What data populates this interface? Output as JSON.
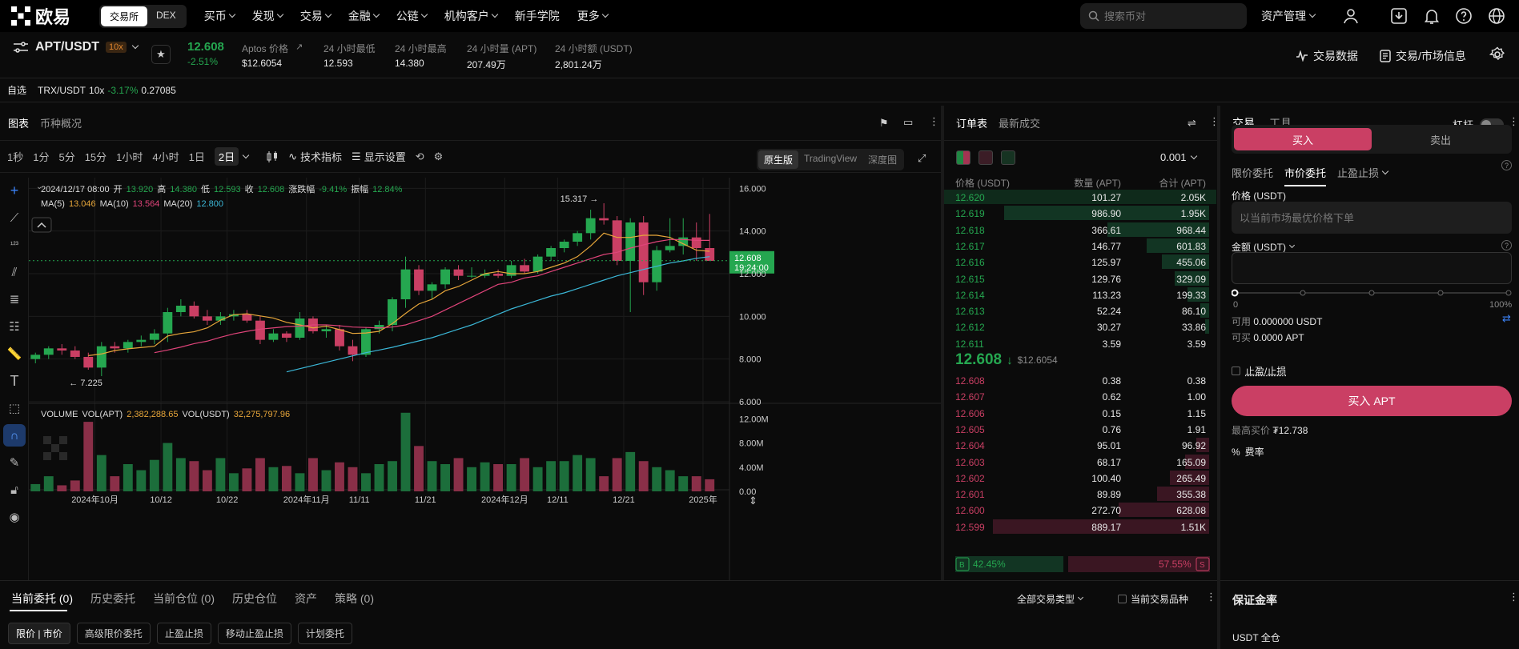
{
  "nav": {
    "brand": "欧易",
    "mode_tabs": [
      "交易所",
      "DEX"
    ],
    "items": [
      "买币",
      "发现",
      "交易",
      "金融",
      "公链",
      "机构客户",
      "新手学院",
      "更多"
    ],
    "items_with_chevron": [
      true,
      true,
      true,
      true,
      true,
      true,
      false,
      true
    ],
    "search_placeholder": "搜索币对",
    "asset_mgmt": "资产管理"
  },
  "ticker": {
    "pair": "APT/USDT",
    "leverage": "10x",
    "last_price": "12.608",
    "change_pct": "-2.51%",
    "stats": [
      {
        "label": "Aptos 价格",
        "value": "$12.6054"
      },
      {
        "label": "24 小时最低",
        "value": "12.593"
      },
      {
        "label": "24 小时最高",
        "value": "14.380"
      },
      {
        "label": "24 小时量 (APT)",
        "value": "207.49万"
      },
      {
        "label": "24 小时额 (USDT)",
        "value": "2,801.24万"
      }
    ],
    "right_links": [
      "交易数据",
      "交易/市场信息"
    ]
  },
  "favbar": {
    "label": "自选",
    "pair": "TRX/USDT",
    "lev": "10x",
    "chg": "-3.17%",
    "price": "0.27085"
  },
  "chart_panel": {
    "tabs": [
      "图表",
      "币种概况"
    ],
    "timeframes": [
      "1秒",
      "1分",
      "5分",
      "15分",
      "1小时",
      "4小时",
      "1日",
      "2日"
    ],
    "active_timeframe": "2日",
    "indicators_label": "技术指标",
    "display_label": "显示设置",
    "views": [
      "原生版",
      "TradingView",
      "深度图"
    ],
    "active_view": "原生版",
    "ohlc": {
      "date": "2024/12/17 08:00",
      "open_label": "开",
      "open": "13.920",
      "high_label": "高",
      "high": "14.380",
      "low_label": "低",
      "low": "12.593",
      "close_label": "收",
      "close": "12.608",
      "chg_label": "涨跌幅",
      "chg": "-9.41%",
      "amp_label": "振幅",
      "amp": "12.84%"
    },
    "ma": {
      "ma5_label": "MA(5)",
      "ma5": "13.046",
      "ma10_label": "MA(10)",
      "ma10": "13.564",
      "ma20_label": "MA(20)",
      "ma20": "12.800"
    },
    "volume": {
      "label": "VOLUME",
      "apt_label": "VOL(APT)",
      "apt": "2,382,288.65",
      "usdt_label": "VOL(USDT)",
      "usdt": "32,275,797.96"
    },
    "current_price_tag": "12.608",
    "countdown": "19:24:00",
    "max_label": "15.317 →",
    "min_label": "← 7.225"
  },
  "chart_data": {
    "type": "candlestick",
    "ylim": [
      6,
      16.5
    ],
    "y_ticks": [
      "16.000",
      "14.000",
      "12.000",
      "10.000",
      "8.000",
      "6.000"
    ],
    "y_tick_values": [
      16,
      14,
      12,
      10,
      8,
      6
    ],
    "x_ticks": [
      "2024年10月",
      "10/12",
      "10/22",
      "2024年11月",
      "11/11",
      "11/21",
      "2024年12月",
      "12/11",
      "12/21",
      "2025年"
    ],
    "x_tick_index": [
      4.5,
      9.5,
      14.5,
      20.5,
      24.5,
      29.5,
      35.5,
      39.5,
      44.5,
      50.5
    ],
    "vol_ticks": [
      "12.00M",
      "8.00M",
      "4.00M",
      "0.00"
    ],
    "vol_tick_values": [
      12,
      8,
      4,
      0
    ],
    "vol_max": 13.5,
    "n_slots": 53,
    "candles": [
      {
        "o": 8.0,
        "h": 8.3,
        "l": 7.8,
        "c": 8.2
      },
      {
        "o": 8.2,
        "h": 8.6,
        "l": 8.0,
        "c": 8.5
      },
      {
        "o": 8.5,
        "h": 8.7,
        "l": 8.2,
        "c": 8.4
      },
      {
        "o": 8.4,
        "h": 8.6,
        "l": 8.0,
        "c": 8.1
      },
      {
        "o": 8.1,
        "h": 8.3,
        "l": 7.5,
        "c": 7.6
      },
      {
        "o": 7.6,
        "h": 8.8,
        "l": 7.2,
        "c": 8.6
      },
      {
        "o": 8.6,
        "h": 8.8,
        "l": 8.3,
        "c": 8.5
      },
      {
        "o": 8.5,
        "h": 8.9,
        "l": 8.3,
        "c": 8.8
      },
      {
        "o": 8.8,
        "h": 9.1,
        "l": 8.6,
        "c": 8.9
      },
      {
        "o": 8.9,
        "h": 9.4,
        "l": 8.7,
        "c": 9.2
      },
      {
        "o": 9.2,
        "h": 10.4,
        "l": 8.8,
        "c": 10.2
      },
      {
        "o": 10.2,
        "h": 10.8,
        "l": 10.0,
        "c": 10.5
      },
      {
        "o": 10.5,
        "h": 10.7,
        "l": 9.9,
        "c": 10.0
      },
      {
        "o": 10.0,
        "h": 10.3,
        "l": 9.6,
        "c": 9.8
      },
      {
        "o": 9.8,
        "h": 10.2,
        "l": 9.6,
        "c": 10.0
      },
      {
        "o": 10.0,
        "h": 10.3,
        "l": 9.8,
        "c": 10.1
      },
      {
        "o": 10.1,
        "h": 10.3,
        "l": 9.7,
        "c": 9.8
      },
      {
        "o": 9.8,
        "h": 10.0,
        "l": 8.7,
        "c": 8.9
      },
      {
        "o": 8.9,
        "h": 9.4,
        "l": 8.8,
        "c": 9.2
      },
      {
        "o": 9.2,
        "h": 9.3,
        "l": 8.8,
        "c": 9.0
      },
      {
        "o": 9.0,
        "h": 10.2,
        "l": 8.9,
        "c": 9.9
      },
      {
        "o": 9.9,
        "h": 10.0,
        "l": 9.2,
        "c": 9.3
      },
      {
        "o": 9.3,
        "h": 9.6,
        "l": 9.0,
        "c": 9.4
      },
      {
        "o": 9.4,
        "h": 9.6,
        "l": 8.4,
        "c": 8.6
      },
      {
        "o": 8.6,
        "h": 8.9,
        "l": 7.9,
        "c": 8.2
      },
      {
        "o": 8.2,
        "h": 9.5,
        "l": 8.1,
        "c": 9.4
      },
      {
        "o": 9.4,
        "h": 9.8,
        "l": 9.2,
        "c": 9.6
      },
      {
        "o": 9.6,
        "h": 10.9,
        "l": 9.3,
        "c": 10.8
      },
      {
        "o": 10.8,
        "h": 12.8,
        "l": 10.4,
        "c": 12.2
      },
      {
        "o": 12.2,
        "h": 12.4,
        "l": 11.0,
        "c": 11.2
      },
      {
        "o": 11.2,
        "h": 11.6,
        "l": 10.8,
        "c": 11.5
      },
      {
        "o": 11.5,
        "h": 12.3,
        "l": 11.3,
        "c": 12.2
      },
      {
        "o": 12.2,
        "h": 12.4,
        "l": 11.7,
        "c": 11.9
      },
      {
        "o": 11.9,
        "h": 12.3,
        "l": 11.8,
        "c": 11.9
      },
      {
        "o": 11.9,
        "h": 12.2,
        "l": 11.8,
        "c": 12.0
      },
      {
        "o": 12.0,
        "h": 12.2,
        "l": 11.8,
        "c": 11.9
      },
      {
        "o": 11.9,
        "h": 12.6,
        "l": 11.8,
        "c": 12.4
      },
      {
        "o": 12.4,
        "h": 12.7,
        "l": 12.0,
        "c": 12.1
      },
      {
        "o": 12.1,
        "h": 12.9,
        "l": 12.0,
        "c": 12.8
      },
      {
        "o": 12.8,
        "h": 13.3,
        "l": 12.6,
        "c": 13.2
      },
      {
        "o": 13.2,
        "h": 13.6,
        "l": 13.0,
        "c": 13.5
      },
      {
        "o": 13.5,
        "h": 14.0,
        "l": 13.3,
        "c": 13.9
      },
      {
        "o": 13.9,
        "h": 15.0,
        "l": 13.6,
        "c": 14.6
      },
      {
        "o": 14.6,
        "h": 15.3,
        "l": 14.3,
        "c": 14.5
      },
      {
        "o": 14.5,
        "h": 14.7,
        "l": 12.4,
        "c": 12.6
      },
      {
        "o": 12.6,
        "h": 14.6,
        "l": 10.2,
        "c": 14.4
      },
      {
        "o": 14.4,
        "h": 14.7,
        "l": 11.0,
        "c": 11.6
      },
      {
        "o": 11.6,
        "h": 13.3,
        "l": 11.2,
        "c": 13.1
      },
      {
        "o": 13.1,
        "h": 14.6,
        "l": 13.0,
        "c": 13.3
      },
      {
        "o": 13.3,
        "h": 14.6,
        "l": 12.9,
        "c": 13.7
      },
      {
        "o": 13.7,
        "h": 14.4,
        "l": 12.6,
        "c": 13.2
      },
      {
        "o": 13.2,
        "h": 14.8,
        "l": 12.6,
        "c": 12.6
      }
    ],
    "volumes": [
      1.2,
      2.5,
      1.0,
      1.8,
      11.5,
      6.0,
      2.5,
      4.5,
      3.5,
      5.2,
      8.0,
      5.5,
      5.0,
      3.5,
      5.5,
      3.0,
      3.8,
      5.5,
      4.0,
      4.2,
      3.0,
      5.5,
      3.5,
      4.8,
      4.0,
      3.0,
      4.5,
      5.0,
      13.0,
      7.5,
      5.0,
      4.5,
      5.5,
      4.0,
      4.8,
      4.5,
      4.5,
      5.5,
      4.0,
      5.0,
      5.0,
      6.0,
      5.5,
      2.5,
      5.5,
      6.5,
      5.0,
      4.0,
      3.5,
      2.5,
      2.5,
      2.0
    ],
    "ma5": [
      null,
      null,
      null,
      null,
      8.16,
      8.24,
      8.4,
      8.48,
      8.54,
      8.6,
      9.08,
      9.2,
      9.28,
      9.46,
      9.82,
      10.08,
      10.12,
      10.02,
      9.92,
      9.72,
      9.6,
      9.46,
      9.54,
      9.38,
      9.2,
      9.22,
      9.3,
      9.66,
      10.14,
      10.58,
      10.8,
      11.2,
      11.4,
      11.7,
      12.0,
      12.1,
      12.0,
      12.0,
      12.1,
      12.3,
      12.5,
      12.8,
      13.3,
      13.9,
      13.7,
      13.7,
      13.8,
      13.8,
      13.7,
      13.4,
      13.1,
      13.05
    ],
    "ma10": [
      null,
      null,
      null,
      null,
      null,
      null,
      null,
      null,
      null,
      8.3,
      8.42,
      8.56,
      8.72,
      8.84,
      9.02,
      9.18,
      9.3,
      9.4,
      9.46,
      9.52,
      9.54,
      9.6,
      9.6,
      9.56,
      9.5,
      9.48,
      9.46,
      9.5,
      9.6,
      9.8,
      10.0,
      10.3,
      10.6,
      10.9,
      11.2,
      11.5,
      11.6,
      11.8,
      11.9,
      12.1,
      12.3,
      12.5,
      12.7,
      12.9,
      13.0,
      13.2,
      13.35,
      13.5,
      13.6,
      13.6,
      13.56,
      13.56
    ],
    "ma20": [
      null,
      null,
      null,
      null,
      null,
      null,
      null,
      null,
      null,
      null,
      null,
      null,
      null,
      null,
      null,
      null,
      null,
      null,
      null,
      7.4,
      7.55,
      7.7,
      7.85,
      8.0,
      8.15,
      8.3,
      8.42,
      8.55,
      8.7,
      8.85,
      9.0,
      9.2,
      9.4,
      9.6,
      9.85,
      10.1,
      10.35,
      10.55,
      10.75,
      10.95,
      11.1,
      11.3,
      11.5,
      11.7,
      11.9,
      12.05,
      12.2,
      12.35,
      12.5,
      12.6,
      12.72,
      12.8
    ]
  },
  "orderbook": {
    "tabs": [
      "订单表",
      "最新成交"
    ],
    "tick": "0.001",
    "headers": [
      "价格 (USDT)",
      "数量 (APT)",
      "合计 (APT)"
    ],
    "asks": [
      {
        "p": "12.620",
        "q": "101.27",
        "t": "2.05K",
        "d": 1.0
      },
      {
        "p": "12.619",
        "q": "986.90",
        "t": "1.95K",
        "d": 0.95
      },
      {
        "p": "12.618",
        "q": "366.61",
        "t": "968.44",
        "d": 0.47
      },
      {
        "p": "12.617",
        "q": "146.77",
        "t": "601.83",
        "d": 0.29
      },
      {
        "p": "12.616",
        "q": "125.97",
        "t": "455.06",
        "d": 0.22
      },
      {
        "p": "12.615",
        "q": "129.76",
        "t": "329.09",
        "d": 0.16
      },
      {
        "p": "12.614",
        "q": "113.23",
        "t": "199.33",
        "d": 0.1
      },
      {
        "p": "12.613",
        "q": "52.24",
        "t": "86.10",
        "d": 0.04
      },
      {
        "p": "12.612",
        "q": "30.27",
        "t": "33.86",
        "d": 0.02
      },
      {
        "p": "12.611",
        "q": "3.59",
        "t": "3.59",
        "d": 0.0
      }
    ],
    "mid_price": "12.608",
    "mid_usd": "$12.6054",
    "bids": [
      {
        "p": "12.608",
        "q": "0.38",
        "t": "0.38",
        "d": 0.0
      },
      {
        "p": "12.607",
        "q": "0.62",
        "t": "1.00",
        "d": 0.0
      },
      {
        "p": "12.606",
        "q": "0.15",
        "t": "1.15",
        "d": 0.0
      },
      {
        "p": "12.605",
        "q": "0.76",
        "t": "1.91",
        "d": 0.0
      },
      {
        "p": "12.604",
        "q": "95.01",
        "t": "96.92",
        "d": 0.06
      },
      {
        "p": "12.603",
        "q": "68.17",
        "t": "165.09",
        "d": 0.11
      },
      {
        "p": "12.602",
        "q": "100.40",
        "t": "265.49",
        "d": 0.18
      },
      {
        "p": "12.601",
        "q": "89.89",
        "t": "355.38",
        "d": 0.24
      },
      {
        "p": "12.600",
        "q": "272.70",
        "t": "628.08",
        "d": 0.42
      },
      {
        "p": "12.599",
        "q": "889.17",
        "t": "1.51K",
        "d": 1.0
      }
    ],
    "buy_pct": "42.45%",
    "sell_pct": "57.55%",
    "buy_ratio": 0.4245,
    "b_label": "B",
    "s_label": "S"
  },
  "trade": {
    "tabs": [
      "交易",
      "工具"
    ],
    "leverage_label": "杠杆",
    "buy": "买入",
    "sell": "卖出",
    "order_types": [
      "限价委托",
      "市价委托",
      "止盈止损"
    ],
    "active_order_type": "市价委托",
    "price_label": "价格 (USDT)",
    "price_placeholder": "以当前市场最优价格下单",
    "amount_label": "金额 (USDT)",
    "slider_min": "0",
    "slider_max": "100%",
    "avail_label": "可用",
    "avail_value": "0.000000 USDT",
    "canbuy_label": "可买",
    "canbuy_value": "0.0000 APT",
    "tpsl_label": "止盈/止损",
    "buy_button": "买入 APT",
    "max_buy_label": "最高买价",
    "max_buy_value": "₮12.738",
    "fee_label": "费率"
  },
  "bottom": {
    "tabs": [
      "当前委托 (0)",
      "历史委托",
      "当前仓位 (0)",
      "历史仓位",
      "资产",
      "策略 (0)"
    ],
    "filter": "全部交易类型",
    "current_only": "当前交易品种",
    "chips": [
      "限价 | 市价",
      "高级限价委托",
      "止盈止损",
      "移动止盈止损",
      "计划委托"
    ],
    "margin_title": "保证金率",
    "margin_sub": "USDT 全仓"
  },
  "colors": {
    "up": "#25a750",
    "down": "#ca3f64",
    "ma5": "#e7a63a",
    "ma10": "#e0447a",
    "ma20": "#3bb7d7"
  }
}
